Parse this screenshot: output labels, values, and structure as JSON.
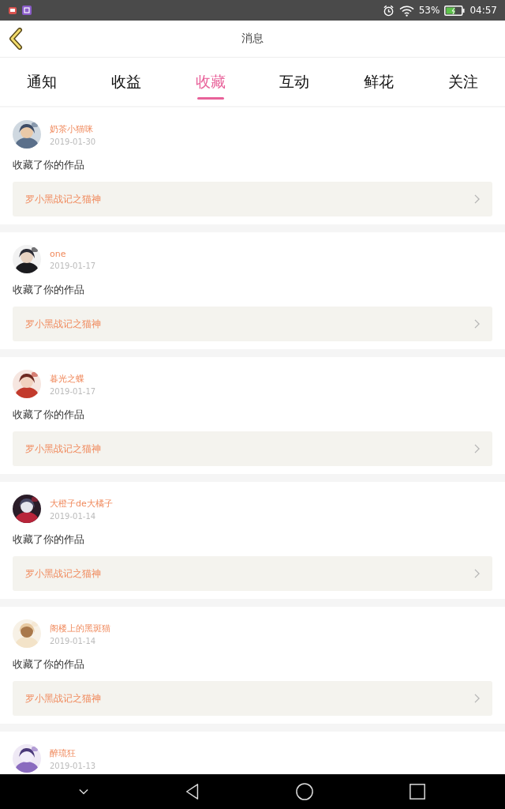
{
  "status_bar": {
    "battery": "53%",
    "time": "04:57"
  },
  "header": {
    "title": "消息"
  },
  "tabs": [
    {
      "label": "通知",
      "selected": false
    },
    {
      "label": "收益",
      "selected": false
    },
    {
      "label": "收藏",
      "selected": true
    },
    {
      "label": "互动",
      "selected": false
    },
    {
      "label": "鲜花",
      "selected": false
    },
    {
      "label": "关注",
      "selected": false
    }
  ],
  "messages": [
    {
      "user": "奶茶小猫咪",
      "date": "2019-01-30",
      "action": "收藏了你的作品",
      "work": "罗小黑战记之猫神"
    },
    {
      "user": "one",
      "date": "2019-01-17",
      "action": "收藏了你的作品",
      "work": "罗小黑战记之猫神"
    },
    {
      "user": "暮光之蝶",
      "date": "2019-01-17",
      "action": "收藏了你的作品",
      "work": "罗小黑战记之猫神"
    },
    {
      "user": "大橙子de大橘子",
      "date": "2019-01-14",
      "action": "收藏了你的作品",
      "work": "罗小黑战记之猫神"
    },
    {
      "user": "阁楼上的黑斑猫",
      "date": "2019-01-14",
      "action": "收藏了你的作品",
      "work": "罗小黑战记之猫神"
    },
    {
      "user": "醉琉狂",
      "date": "2019-01-13"
    }
  ]
}
